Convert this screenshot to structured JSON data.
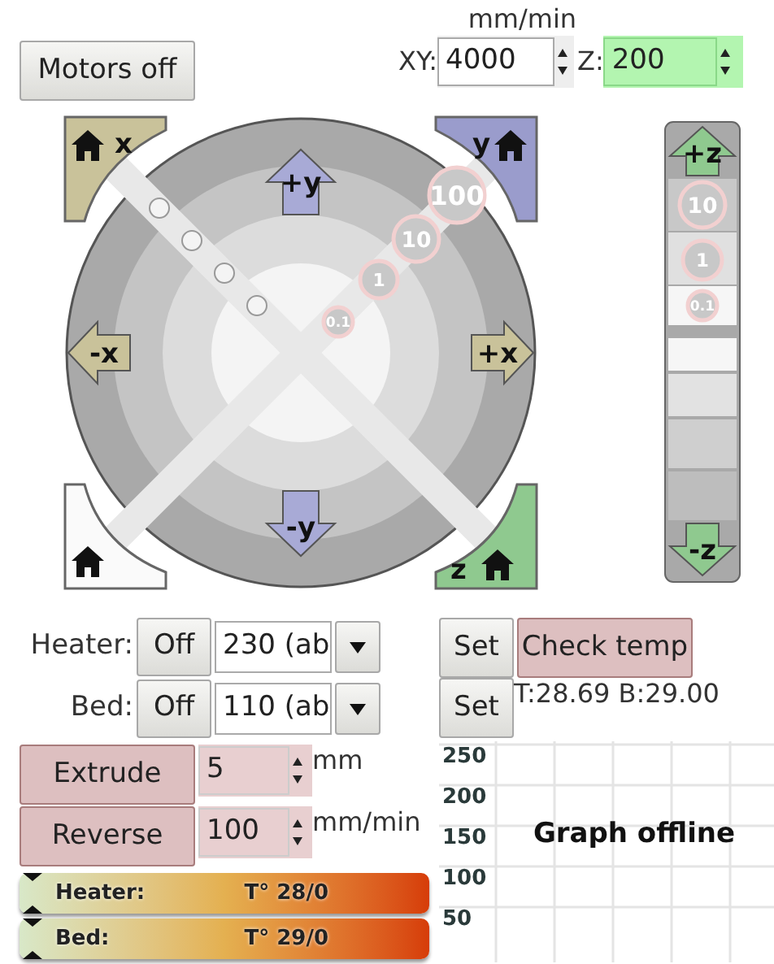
{
  "motors_button": "Motors off",
  "speed": {
    "unit": "mm/min",
    "xy_label": "XY:",
    "xy_value": "4000",
    "z_label": "Z:",
    "z_value": "200"
  },
  "jog": {
    "home_x": "x",
    "home_y": "y",
    "home_z": "z",
    "plus_y": "+y",
    "minus_y": "-y",
    "minus_x": "-x",
    "plus_x": "+x",
    "steps": [
      "100",
      "10",
      "1",
      "0.1"
    ]
  },
  "z_jog": {
    "plus": "+z",
    "minus": "-z",
    "steps": [
      "10",
      "1",
      "0.1"
    ]
  },
  "heater": {
    "label": "Heater:",
    "off": "Off",
    "value": "230 (ab"
  },
  "bed": {
    "label": "Bed:",
    "off": "Off",
    "value": "110 (ab"
  },
  "set_buttons": [
    "Set",
    "Set"
  ],
  "check_temp": "Check temp",
  "temps": "T:28.69 B:29.00",
  "extrude": {
    "button": "Extrude",
    "value": "5",
    "unit": "mm"
  },
  "reverse": {
    "button": "Reverse",
    "value": "100",
    "unit": "mm/min"
  },
  "gauges": [
    {
      "label": "Heater:",
      "reading": "T° 28/0"
    },
    {
      "label": "Bed:",
      "reading": "T° 29/0"
    }
  ],
  "graph": {
    "yticks": [
      "250",
      "200",
      "150",
      "100",
      "50"
    ],
    "message": "Graph offline"
  }
}
